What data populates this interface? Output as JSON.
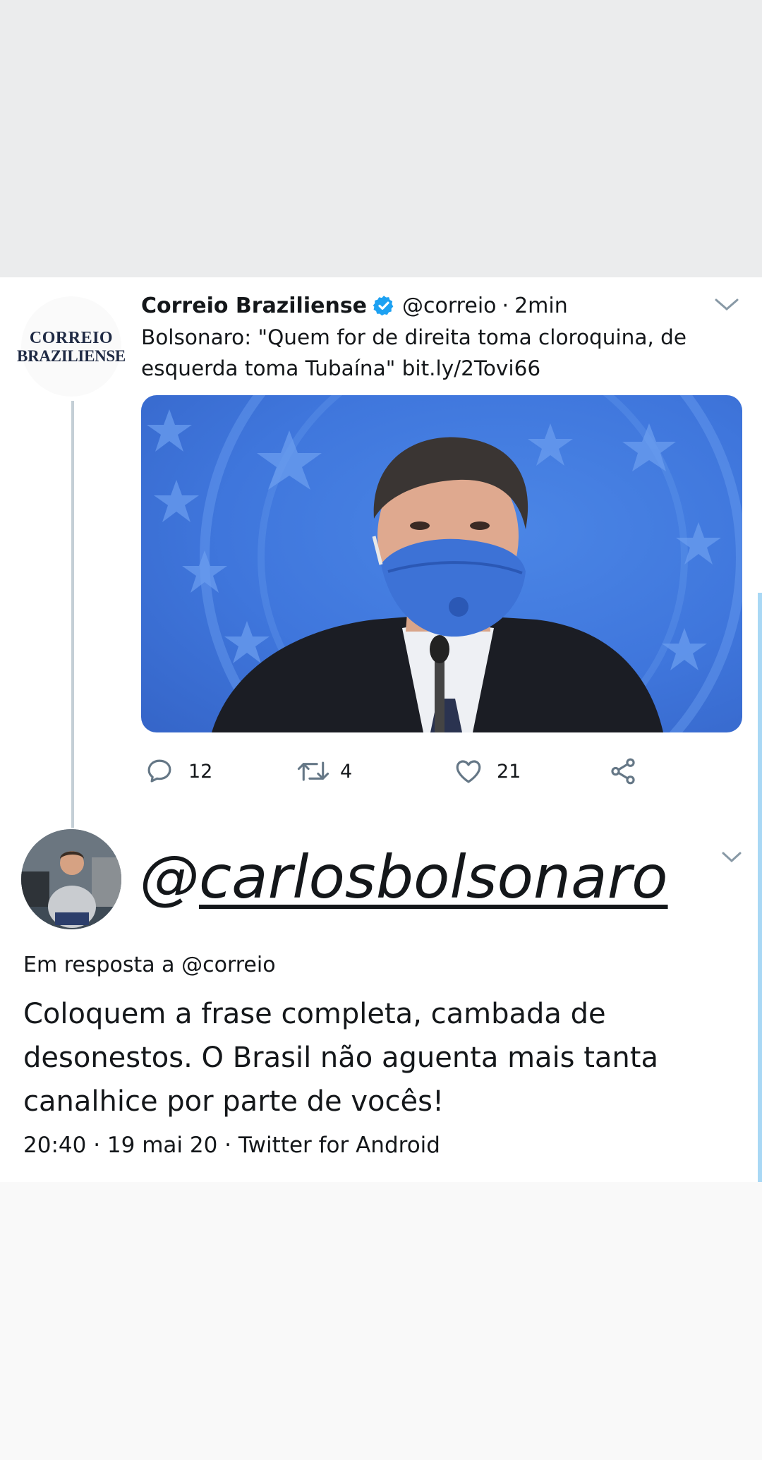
{
  "colors": {
    "verified": "#1da1f2",
    "text": "#14171a",
    "icon": "#657786",
    "thread_line": "#c4cfd6",
    "scrollbar": "#a9d8f5",
    "photo_background": "#3f76dc"
  },
  "tweet": {
    "author_name": "Correio Braziliense",
    "handle": "@correio",
    "dot": "·",
    "time": "2min",
    "avatar_logo": {
      "line1": "Correio",
      "line2": "Braziliense"
    },
    "text": "Bolsonaro: \"Quem for de direita toma cloroquina, de esquerda toma Tubaína\" bit.ly/2Tovi66",
    "actions": {
      "replies": "12",
      "retweets": "4",
      "likes": "21"
    },
    "icons": [
      "verified-badge-icon",
      "chevron-down-icon",
      "reply-icon",
      "retweet-icon",
      "like-icon",
      "share-icon"
    ]
  },
  "reply": {
    "handle": "@carlosbolsonaro",
    "in_reply_to": "Em resposta a @correio",
    "text": "Coloquem a frase completa, cambada de desonestos. O Brasil não aguenta mais tanta canalhice por parte de vocês!",
    "meta": "20:40 · 19 mai 20 · Twitter for Android"
  }
}
